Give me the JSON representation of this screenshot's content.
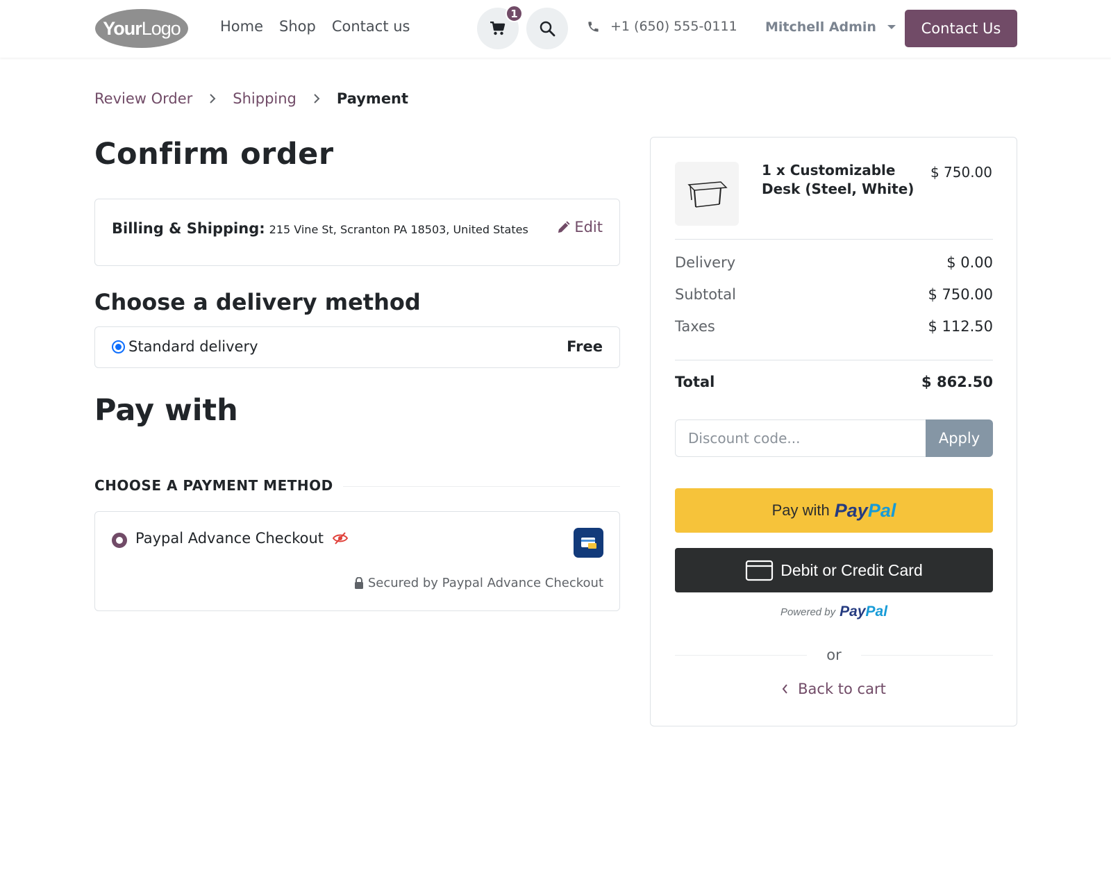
{
  "header": {
    "logo_text": "YourLogo",
    "nav": [
      "Home",
      "Shop",
      "Contact us"
    ],
    "cart_count": "1",
    "phone": "+1 (650) 555-0111",
    "user_name": "Mitchell Admin",
    "contact_button": "Contact Us"
  },
  "breadcrumb": {
    "steps": [
      "Review Order",
      "Shipping"
    ],
    "current": "Payment"
  },
  "main": {
    "title": "Confirm order",
    "billing": {
      "label": "Billing & Shipping:",
      "address": "215 Vine St, Scranton PA 18503, United States",
      "edit_label": "Edit"
    },
    "delivery": {
      "heading": "Choose a delivery method",
      "method": "Standard delivery",
      "price": "Free",
      "selected": true
    },
    "pay_with": {
      "heading": "Pay with",
      "section_title": "CHOOSE A PAYMENT METHOD",
      "provider": "Paypal Advance Checkout",
      "secured": "Secured by Paypal Advance Checkout"
    }
  },
  "summary": {
    "product": {
      "name": "1 x Customizable Desk (Steel, White)",
      "price": "$ 750.00"
    },
    "rows": [
      {
        "label": "Delivery",
        "value": "$ 0.00"
      },
      {
        "label": "Subtotal",
        "value": "$ 750.00"
      },
      {
        "label": "Taxes",
        "value": "$ 112.50"
      }
    ],
    "total": {
      "label": "Total",
      "value": "$ 862.50"
    },
    "discount": {
      "placeholder": "Discount code...",
      "apply_label": "Apply"
    },
    "paypal_button": {
      "prefix": "Pay with",
      "brand_a": "Pay",
      "brand_b": "Pal"
    },
    "card_button": "Debit or Credit Card",
    "powered_by": "Powered by",
    "or": "or",
    "back_to_cart": "Back to cart"
  },
  "colors": {
    "brand": "#714b67",
    "paypal_yellow": "#f6c33a",
    "card_dark": "#2c2e2f",
    "apply_gray": "#8596a5",
    "radio_blue": "#0d6efd"
  },
  "icons": {
    "cart": "cart-icon",
    "search": "search-icon",
    "phone": "phone-icon",
    "edit": "pencil-icon",
    "lock": "lock-icon",
    "hidden": "eye-slash-icon",
    "back": "chevron-left-icon"
  }
}
